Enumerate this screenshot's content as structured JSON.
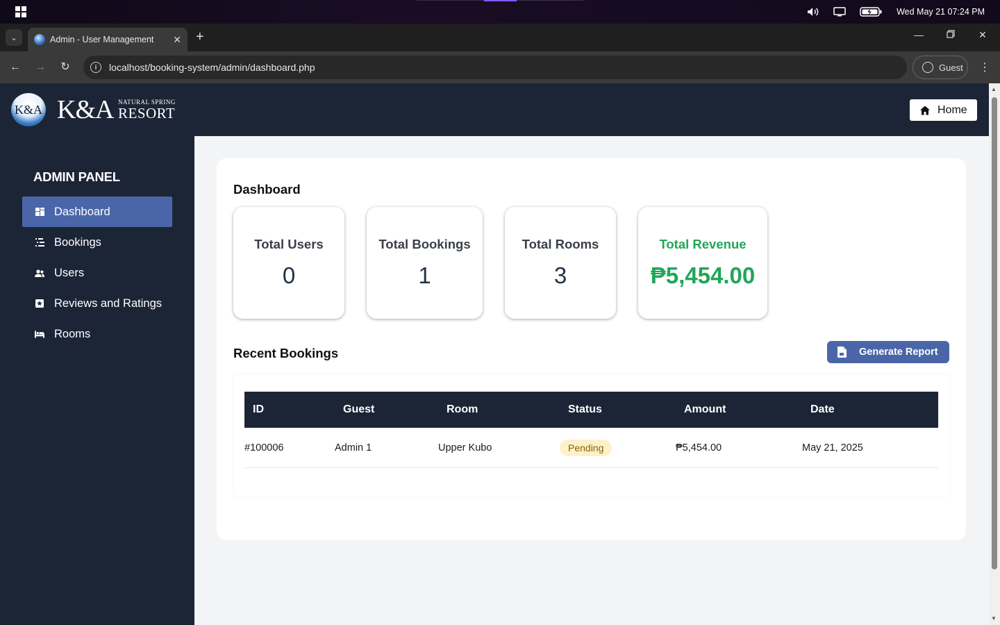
{
  "os": {
    "clock": "Wed May 21  07:24 PM",
    "icons": [
      "windows-logo-icon",
      "volume-icon",
      "display-icon",
      "battery-icon"
    ]
  },
  "browser": {
    "tab_title": "Admin - User Management",
    "url": "localhost/booking-system/admin/dashboard.php",
    "profile_label": "Guest"
  },
  "header": {
    "logo_badge": "K&A",
    "logo_ka": "K&A",
    "logo_small": "NATURAL SPRING",
    "logo_resort": "RESORT",
    "home_label": "Home"
  },
  "sidebar": {
    "title": "ADMIN PANEL",
    "items": [
      {
        "label": "Dashboard",
        "icon": "dashboard-icon",
        "active": true
      },
      {
        "label": "Bookings",
        "icon": "bookings-icon",
        "active": false
      },
      {
        "label": "Users",
        "icon": "users-icon",
        "active": false
      },
      {
        "label": "Reviews and Ratings",
        "icon": "star-box-icon",
        "active": false
      },
      {
        "label": "Rooms",
        "icon": "bed-icon",
        "active": false
      }
    ]
  },
  "dashboard": {
    "title": "Dashboard",
    "stats": [
      {
        "label": "Total Users",
        "value": "0"
      },
      {
        "label": "Total Bookings",
        "value": "1"
      },
      {
        "label": "Total Rooms",
        "value": "3"
      },
      {
        "label": "Total Revenue",
        "value": "₱5,454.00"
      }
    ],
    "accent_green": "#22a55a",
    "accent_blue": "#4b66a8"
  },
  "recent": {
    "title": "Recent Bookings",
    "report_label": "Generate Report",
    "columns": [
      "ID",
      "Guest",
      "Room",
      "Status",
      "Amount",
      "Date"
    ],
    "rows": [
      {
        "id": "#100006",
        "guest": "Admin 1",
        "room": "Upper Kubo",
        "status": "Pending",
        "amount": "₱5,454.00",
        "date": "May 21, 2025"
      }
    ]
  }
}
